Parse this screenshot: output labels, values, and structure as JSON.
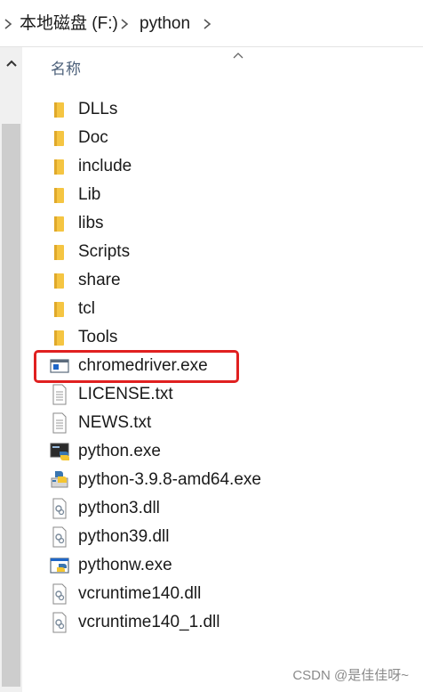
{
  "address_bar": {
    "crumbs": [
      "本地磁盘 (F:)",
      "python"
    ]
  },
  "column_header": {
    "name_label": "名称"
  },
  "files": [
    {
      "name": "DLLs",
      "icon": "folder-icon"
    },
    {
      "name": "Doc",
      "icon": "folder-icon"
    },
    {
      "name": "include",
      "icon": "folder-icon"
    },
    {
      "name": "Lib",
      "icon": "folder-icon"
    },
    {
      "name": "libs",
      "icon": "folder-icon"
    },
    {
      "name": "Scripts",
      "icon": "folder-icon"
    },
    {
      "name": "share",
      "icon": "folder-icon"
    },
    {
      "name": "tcl",
      "icon": "folder-icon"
    },
    {
      "name": "Tools",
      "icon": "folder-icon"
    },
    {
      "name": "chromedriver.exe",
      "icon": "exe-window-icon"
    },
    {
      "name": "LICENSE.txt",
      "icon": "text-file-icon"
    },
    {
      "name": "NEWS.txt",
      "icon": "text-file-icon"
    },
    {
      "name": "python.exe",
      "icon": "python-exe-icon"
    },
    {
      "name": "python-3.9.8-amd64.exe",
      "icon": "installer-icon"
    },
    {
      "name": "python3.dll",
      "icon": "dll-file-icon"
    },
    {
      "name": "python39.dll",
      "icon": "dll-file-icon"
    },
    {
      "name": "pythonw.exe",
      "icon": "pythonw-exe-icon"
    },
    {
      "name": "vcruntime140.dll",
      "icon": "dll-file-icon"
    },
    {
      "name": "vcruntime140_1.dll",
      "icon": "dll-file-icon"
    }
  ],
  "highlighted_file": "chromedriver.exe",
  "highlight_color": "#e02020",
  "folder_color": "#f5c542",
  "watermark": "CSDN @是佳佳呀~"
}
